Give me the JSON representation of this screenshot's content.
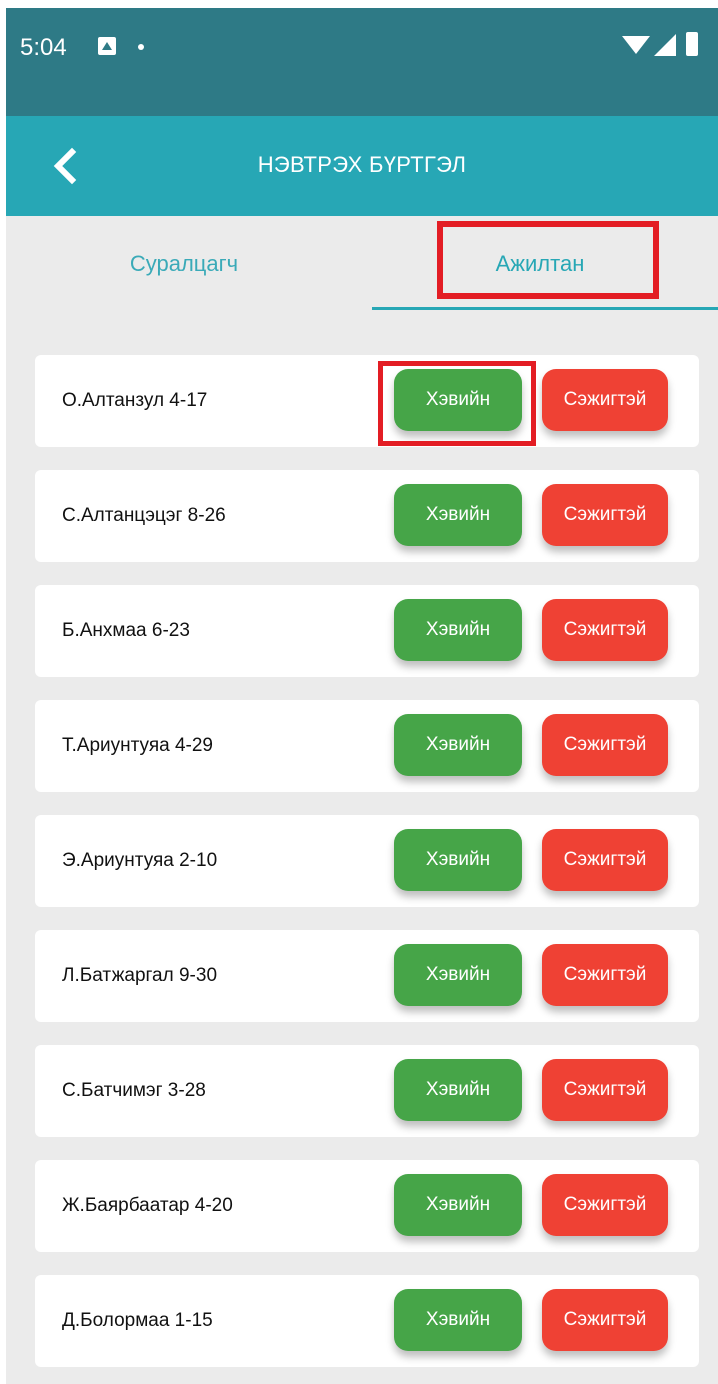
{
  "status_bar": {
    "time": "5:04",
    "icons": [
      "notification-icon",
      "dot-icon",
      "wifi-icon",
      "signal-icon",
      "battery-icon"
    ]
  },
  "app_bar": {
    "title": "НЭВТРЭХ БҮРТГЭЛ",
    "back_icon": "chevron-left-icon"
  },
  "tabs": [
    {
      "label": "Суралцагч",
      "selected": false
    },
    {
      "label": "Ажилтан",
      "selected": true
    }
  ],
  "rows": [
    {
      "name": "О.Алтанзул  4-17",
      "normal_label": "Хэвийн",
      "concern_label": "Сэжигтэй"
    },
    {
      "name": "С.Алтанцэцэг  8-26",
      "normal_label": "Хэвийн",
      "concern_label": "Сэжигтэй"
    },
    {
      "name": "Б.Анхмаа  6-23",
      "normal_label": "Хэвийн",
      "concern_label": "Сэжигтэй"
    },
    {
      "name": "Т.Ариунтуяа  4-29",
      "normal_label": "Хэвийн",
      "concern_label": "Сэжигтэй"
    },
    {
      "name": "Э.Ариунтуяа  2-10",
      "normal_label": "Хэвийн",
      "concern_label": "Сэжигтэй"
    },
    {
      "name": "Л.Батжаргал  9-30",
      "normal_label": "Хэвийн",
      "concern_label": "Сэжигтэй"
    },
    {
      "name": "С.Батчимэг  3-28",
      "normal_label": "Хэвийн",
      "concern_label": "Сэжигтэй"
    },
    {
      "name": "Ж.Баярбаатар  4-20",
      "normal_label": "Хэвийн",
      "concern_label": "Сэжигтэй"
    },
    {
      "name": "Д.Болормаа  1-15",
      "normal_label": "Хэвийн",
      "concern_label": "Сэжигтэй"
    }
  ],
  "colors": {
    "status_bar": "#2e7a86",
    "app_bar": "#27a7b5",
    "background": "#ebebeb",
    "normal_button": "#46a548",
    "concern_button": "#ef4134",
    "highlight": "#e31d24"
  }
}
